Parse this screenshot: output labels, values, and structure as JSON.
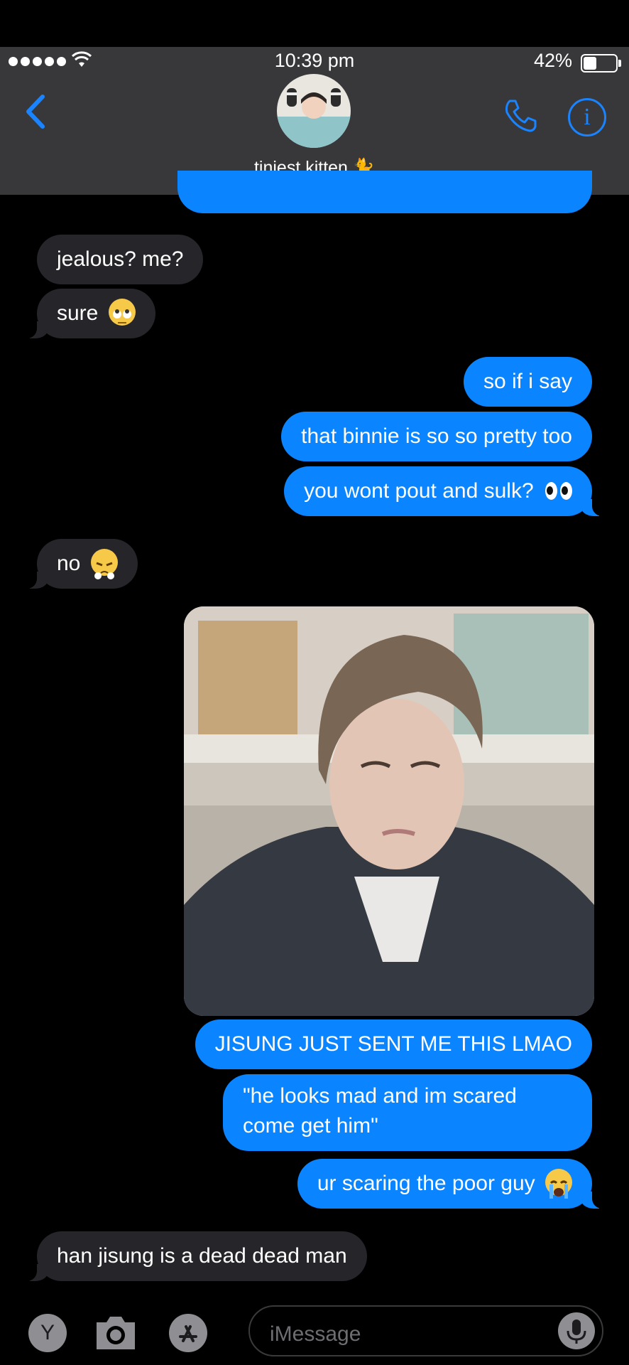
{
  "status_bar": {
    "time": "10:39 pm",
    "battery": "42%",
    "battery_level": 0.42
  },
  "header": {
    "contact_name": "tiniest kitten 🐈"
  },
  "colors": {
    "outgoing": "#0b84ff",
    "incoming": "#26252a",
    "accent": "#1a84ff",
    "background": "#000000"
  },
  "messages": [
    {
      "side": "in",
      "text": "jealous? me?"
    },
    {
      "side": "in",
      "text": "sure",
      "emoji": "face-with-rolling-eyes"
    },
    {
      "side": "out",
      "text": "so if i say"
    },
    {
      "side": "out",
      "text": "that binnie is so so pretty too"
    },
    {
      "side": "out",
      "text": "you wont pout and sulk?",
      "emoji": "eyes"
    },
    {
      "side": "in",
      "text": "no",
      "emoji": "face-with-steam-from-nose"
    },
    {
      "side": "out",
      "type": "image"
    },
    {
      "side": "out",
      "text": "JISUNG JUST SENT ME THIS LMAO"
    },
    {
      "side": "out",
      "text": "\"he looks mad and im scared come get him\""
    },
    {
      "side": "out",
      "text": "ur scaring the poor guy",
      "emoji": "loudly-crying-face"
    },
    {
      "side": "in",
      "text": "han jisung is a dead dead man"
    }
  ],
  "input_bar": {
    "placeholder": "iMessage",
    "apps_button": "Y"
  },
  "icons": [
    "back-chevron-icon",
    "phone-icon",
    "info-icon",
    "camera-icon",
    "app-store-icon",
    "microphone-icon",
    "wifi-icon"
  ]
}
